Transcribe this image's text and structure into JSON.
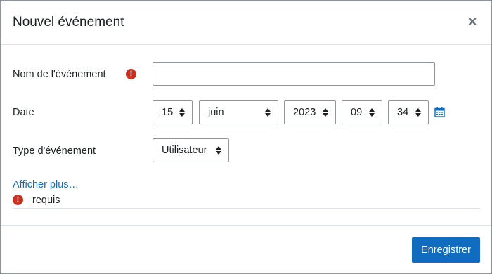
{
  "dialog": {
    "title": "Nouvel événement",
    "close_symbol": "×"
  },
  "form": {
    "name": {
      "label": "Nom de l'événement",
      "value": "",
      "required": true
    },
    "date": {
      "label": "Date",
      "day": "15",
      "month": "juin",
      "year": "2023",
      "hour": "09",
      "minute": "34",
      "calendar_icon": "calendar-icon"
    },
    "event_type": {
      "label": "Type d'événement",
      "value": "Utilisateur"
    },
    "show_more": "Afficher plus…",
    "required_note": "requis",
    "required_symbol": "!"
  },
  "footer": {
    "save_label": "Enregistrer"
  },
  "colors": {
    "primary": "#0f6cbf",
    "required": "#ca3120",
    "border": "#8f959e"
  }
}
